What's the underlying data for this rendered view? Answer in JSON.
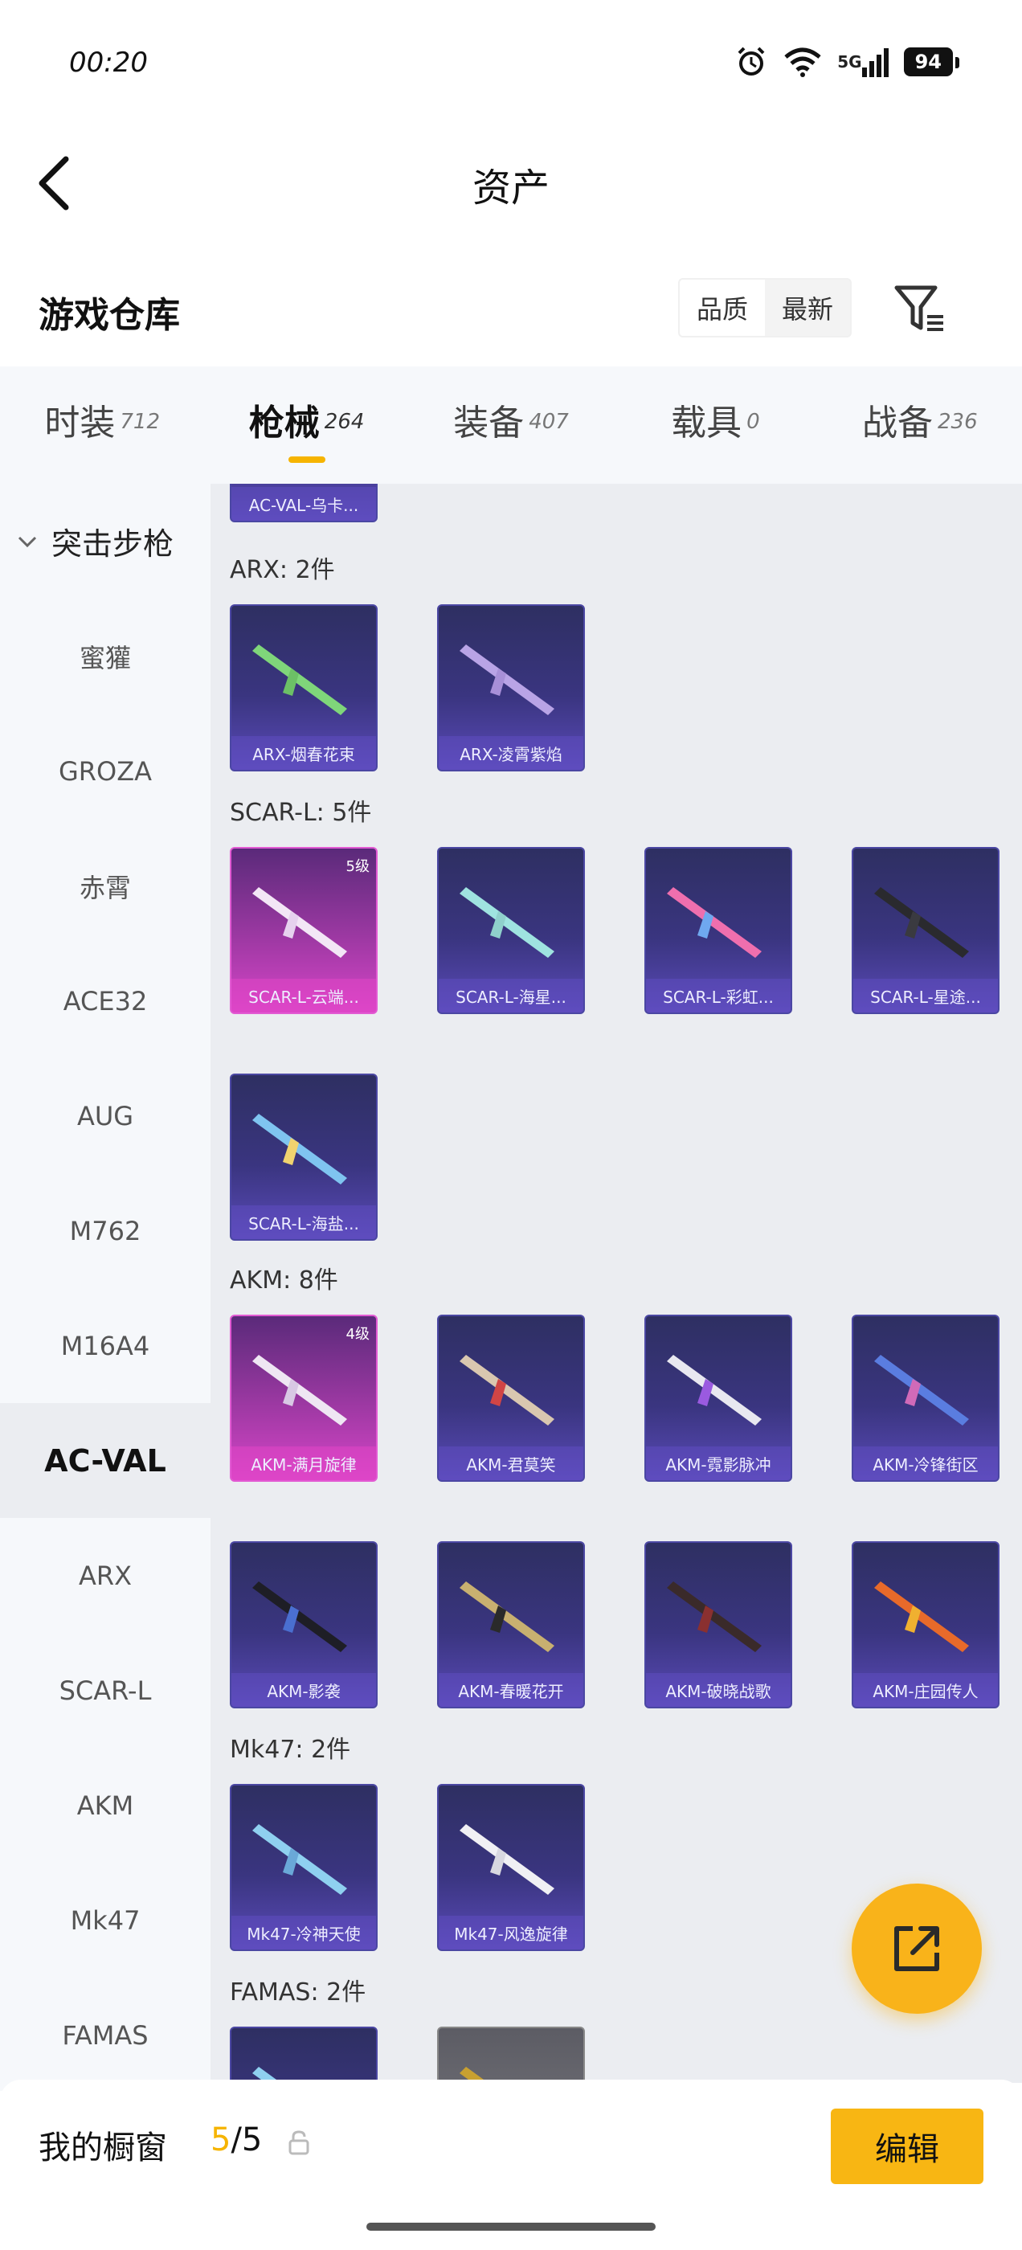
{
  "status": {
    "time": "00:20",
    "network": "5G",
    "battery": "94"
  },
  "header": {
    "title": "资产"
  },
  "warehouse": {
    "title": "游戏仓库",
    "sort_options": [
      "品质",
      "最新"
    ],
    "active_sort": 1
  },
  "tabs": [
    {
      "label": "时装",
      "count": "712"
    },
    {
      "label": "枪械",
      "count": "264"
    },
    {
      "label": "装备",
      "count": "407"
    },
    {
      "label": "载具",
      "count": "0"
    },
    {
      "label": "战备",
      "count": "236"
    }
  ],
  "active_tab": 1,
  "sidebar": {
    "group": "突击步枪",
    "items": [
      "蜜獾",
      "GROZA",
      "赤霄",
      "ACE32",
      "AUG",
      "M762",
      "M16A4",
      "AC-VAL",
      "ARX",
      "SCAR-L",
      "AKM",
      "Mk47",
      "FAMAS"
    ],
    "active": "AC-VAL"
  },
  "content": {
    "top_partial_card": "AC-VAL-乌卡...",
    "groups": [
      {
        "label": "ARX: 2件",
        "items": [
          {
            "name": "ARX-烟春花束"
          },
          {
            "name": "ARX-凌霄紫焰"
          }
        ]
      },
      {
        "label": "SCAR-L: 5件",
        "items": [
          {
            "name": "SCAR-L-云端...",
            "badge": "5级",
            "pink": true
          },
          {
            "name": "SCAR-L-海星..."
          },
          {
            "name": "SCAR-L-彩虹..."
          },
          {
            "name": "SCAR-L-星途..."
          },
          {
            "name": "SCAR-L-海盐..."
          }
        ]
      },
      {
        "label": "AKM: 8件",
        "items": [
          {
            "name": "AKM-满月旋律",
            "badge": "4级",
            "pink": true
          },
          {
            "name": "AKM-君莫笑"
          },
          {
            "name": "AKM-霓影脉冲"
          },
          {
            "name": "AKM-冷锋街区"
          },
          {
            "name": "AKM-影袭"
          },
          {
            "name": "AKM-春暖花开"
          },
          {
            "name": "AKM-破晓战歌"
          },
          {
            "name": "AKM-庄园传人"
          }
        ]
      },
      {
        "label": "Mk47: 2件",
        "items": [
          {
            "name": "Mk47-冷神天使"
          },
          {
            "name": "Mk47-风逸旋律"
          }
        ]
      },
      {
        "label": "FAMAS: 2件",
        "items": []
      }
    ]
  },
  "showcase": {
    "label": "我的橱窗",
    "current": "5",
    "total": "/5"
  },
  "edit_button": {
    "label": "编辑"
  }
}
